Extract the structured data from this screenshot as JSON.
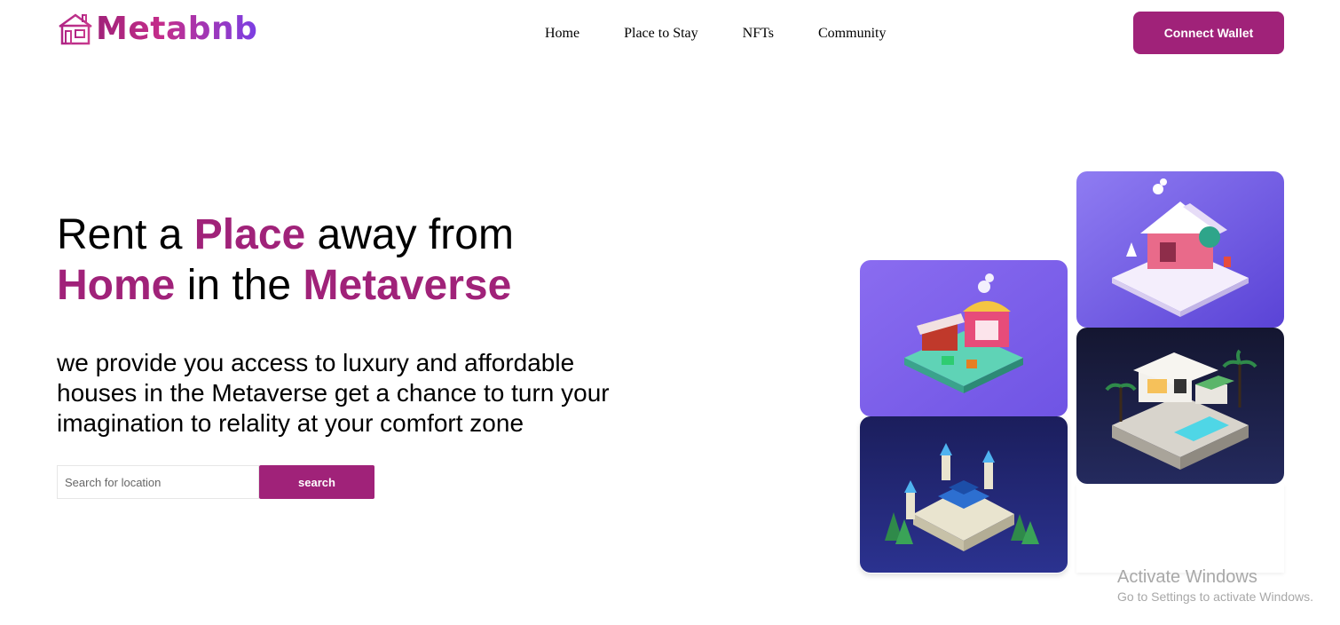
{
  "brand": {
    "name": "Metabnb",
    "icon": "house-icon",
    "colors": {
      "primary": "#a02279",
      "gradient_end": "#7b3fe4"
    }
  },
  "nav": {
    "items": [
      "Home",
      "Place to Stay",
      "NFTs",
      "Community"
    ]
  },
  "header": {
    "connect_label": "Connect Wallet"
  },
  "hero": {
    "headline": {
      "part1": "Rent a ",
      "highlight1": "Place",
      "part2": " away from",
      "highlight2": "Home",
      "part3": " in the ",
      "highlight3": "Metaverse"
    },
    "description": "we provide you access to luxury and affordable houses in the Metaverse get a chance to turn your imagination to relality at your comfort zone",
    "search": {
      "placeholder": "Search for location",
      "button_label": "search"
    }
  },
  "gallery": {
    "tiles": [
      {
        "name": "market-stall-tile",
        "theme": "purple"
      },
      {
        "name": "snow-cabin-tile",
        "theme": "purple"
      },
      {
        "name": "castle-tile",
        "theme": "dark-blue"
      },
      {
        "name": "modern-villa-tile",
        "theme": "dark-navy"
      }
    ]
  },
  "watermark": {
    "title": "Activate Windows",
    "subtitle": "Go to Settings to activate Windows."
  }
}
